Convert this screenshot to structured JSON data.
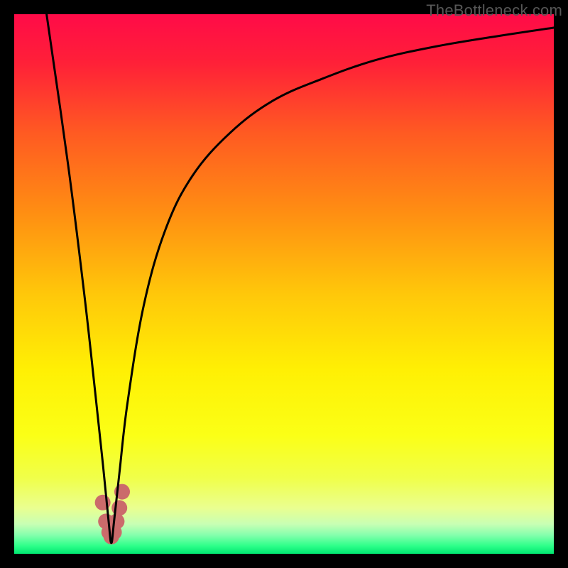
{
  "watermark": "TheBottleneck.com",
  "chart_data": {
    "type": "line",
    "title": "",
    "xlabel": "",
    "ylabel": "",
    "xlim": [
      0,
      100
    ],
    "ylim": [
      0,
      100
    ],
    "x_optimum": 18,
    "series": [
      {
        "name": "bottleneck-curve",
        "x": [
          6,
          10,
          13,
          15,
          16.5,
          17.5,
          18,
          18.5,
          19.5,
          21,
          24,
          28,
          33,
          40,
          48,
          57,
          67,
          78,
          90,
          100
        ],
        "values": [
          100,
          72,
          48,
          30,
          16,
          6,
          2,
          6,
          15,
          28,
          46,
          60,
          70,
          78,
          84,
          88,
          91.5,
          94,
          96,
          97.5
        ]
      }
    ],
    "markers": {
      "name": "highlight-cluster",
      "x": [
        16.4,
        17.0,
        17.6,
        18.0,
        18.5,
        19.0,
        19.5,
        20.0
      ],
      "values": [
        9.5,
        6.0,
        4.0,
        3.2,
        4.0,
        6.0,
        8.5,
        11.5
      ],
      "color": "#cb6b6b",
      "radius": 11
    },
    "gradient_stops": [
      {
        "offset": 0.0,
        "color": "#ff0b48"
      },
      {
        "offset": 0.09,
        "color": "#ff2038"
      },
      {
        "offset": 0.22,
        "color": "#ff5a22"
      },
      {
        "offset": 0.37,
        "color": "#ff8f12"
      },
      {
        "offset": 0.52,
        "color": "#ffc80a"
      },
      {
        "offset": 0.66,
        "color": "#fff004"
      },
      {
        "offset": 0.78,
        "color": "#fbff16"
      },
      {
        "offset": 0.86,
        "color": "#f0ff4a"
      },
      {
        "offset": 0.915,
        "color": "#eaff90"
      },
      {
        "offset": 0.945,
        "color": "#c8ffb4"
      },
      {
        "offset": 0.965,
        "color": "#86ffad"
      },
      {
        "offset": 0.985,
        "color": "#2fff8a"
      },
      {
        "offset": 1.0,
        "color": "#00e870"
      }
    ]
  }
}
